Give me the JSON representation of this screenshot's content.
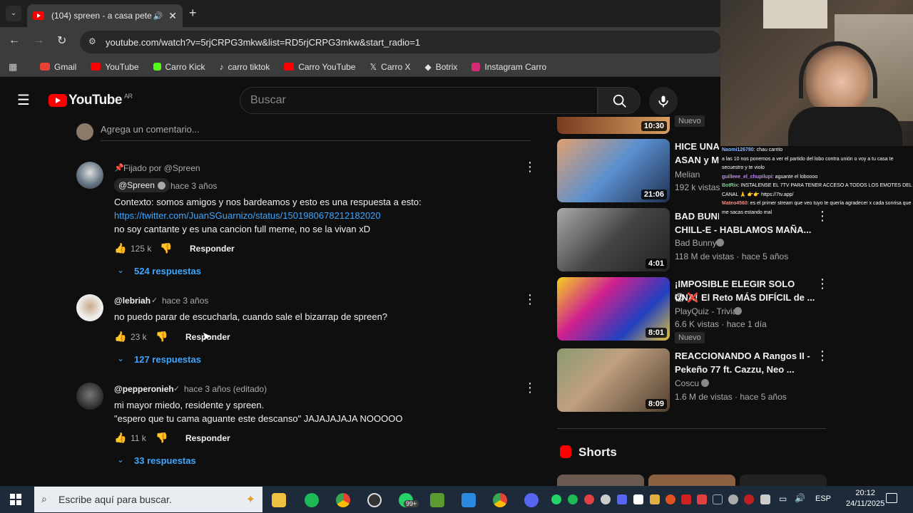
{
  "browser": {
    "tab_title": "(104) spreen - a casa pete",
    "url": "youtube.com/watch?v=5rjCRPG3mkw&list=RD5rjCRPG3mkw&start_radio=1",
    "bookmarks": [
      {
        "label": "Gmail",
        "color": "#ea4335"
      },
      {
        "label": "YouTube",
        "color": "#ff0000"
      },
      {
        "label": "Carro Kick",
        "color": "#53fc18"
      },
      {
        "label": "carro tiktok",
        "color": "#ffffff"
      },
      {
        "label": "Carro YouTube",
        "color": "#ff0000"
      },
      {
        "label": "Carro X",
        "color": "#ffffff"
      },
      {
        "label": "Botrix",
        "color": "#ffffff"
      },
      {
        "label": "Instagram Carro",
        "color": "#d62976"
      }
    ]
  },
  "youtube": {
    "logo_text": "YouTube",
    "region": "AR",
    "search_placeholder": "Buscar"
  },
  "comments": {
    "add_placeholder": "Agrega un comentario...",
    "items": [
      {
        "pinned": "Fijado por @Spreen",
        "author": "@Spreen",
        "time": "hace 3 años",
        "lines": [
          "Contexto: somos amigos y nos bardeamos y esto es una respuesta a esto:",
          "https://twitter.com/JuanSGuarnizo/status/1501980678212182020",
          "no soy cantante y es una cancion full meme, no se la vivan xD"
        ],
        "likes": "125 k",
        "reply_label": "Responder",
        "replies": "524 respuestas"
      },
      {
        "author": "@lebriah",
        "time": "hace 3 años",
        "lines": [
          "no puedo parar de escucharla, cuando sale el bizarrap de spreen?"
        ],
        "likes": "23 k",
        "reply_label": "Responder",
        "replies": "127 respuestas"
      },
      {
        "author": "@pepperonieh",
        "time": "hace 3 años (editado)",
        "lines": [
          "mi mayor miedo, residente y spreen.",
          "\"espero que tu cama aguante este descanso\" JAJAJAJAJA NOOOOO"
        ],
        "likes": "11 k",
        "reply_label": "Responder",
        "replies": "33 respuestas"
      }
    ]
  },
  "sidebar": {
    "top_badge": "Nuevo",
    "top_duration": "10:30",
    "videos": [
      {
        "title": "HICE UNA PELEA DE MORTEDOR",
        "title2": "ASAN y MORTEDOR",
        "channel": "Melian",
        "stats": "192 k vistas",
        "duration": "21:06"
      },
      {
        "title": "BAD BUNNY | DUKI Y PABLO",
        "title2": "CHILL-E - HABLAMOS MAÑA...",
        "channel": "Bad Bunny",
        "stats": "118 M de vistas · hace 5 años",
        "duration": "4:01"
      },
      {
        "title": "¡IMPOSIBLE ELEGIR SOLO UNA!",
        "title2": "😱 ❌ El Reto MÁS DIFÍCIL de ...",
        "channel": "PlayQuiz - Trivia",
        "stats": "6.6 K vistas · hace 1 día",
        "duration": "8:01",
        "badge": "Nuevo"
      },
      {
        "title": "REACCIONANDO A Rangos II -",
        "title2": "Pekeño 77 ft. Cazzu, Neo ...",
        "channel": "Coscu",
        "stats": "1.6 M de vistas · hace 5 años",
        "duration": "8:09"
      }
    ],
    "shorts_label": "Shorts"
  },
  "stream_chat": [
    {
      "user": "Naomi126780",
      "msg": ": chau carrito"
    },
    {
      "user": "",
      "msg": "a las 10 nos ponemos a ver el partido del lobo contra unión o voy a tu casa te secuestro y te violo"
    },
    {
      "user": "guilleee_el_chupilupi",
      "msg": ": aguante el loboooo"
    },
    {
      "user": "BotRix",
      "msg": ": INSTALENSE EL 7TV PARA TENER ACCESO A TODOS LOS EMOTES DEL CANAL 🙏 👉👉 https://7tv.app/"
    },
    {
      "user": "Mateo4560",
      "msg": ": es el primer stream que veo tuyo te quería agradecer x cada sonrisa que me sacas estando mal"
    }
  ],
  "taskbar": {
    "search_placeholder": "Escribe aquí para buscar.",
    "lang": "ESP",
    "time": "20:12",
    "date": "24/11/2025",
    "badge": "99+"
  }
}
